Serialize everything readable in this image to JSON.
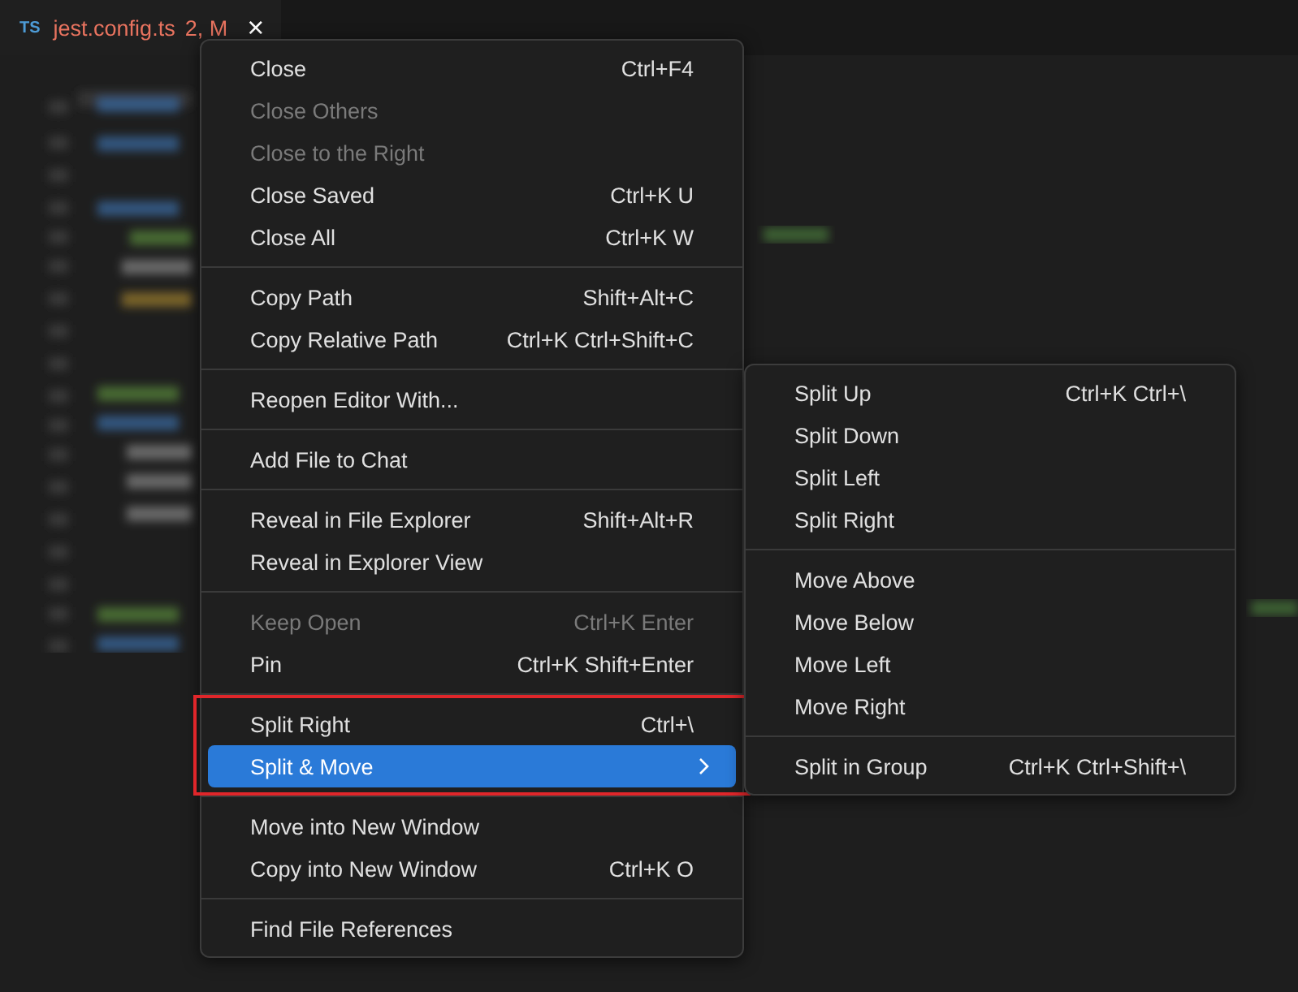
{
  "tab": {
    "type_badge": "TS",
    "filename": "jest.config.ts",
    "status": "2, M",
    "close": "×"
  },
  "context_menu": {
    "groups": [
      {
        "items": [
          {
            "label": "Close",
            "shortcut": "Ctrl+F4",
            "disabled": false,
            "selected": false,
            "submenu": false
          },
          {
            "label": "Close Others",
            "disabled": true,
            "selected": false,
            "submenu": false
          },
          {
            "label": "Close to the Right",
            "disabled": true,
            "selected": false,
            "submenu": false
          },
          {
            "label": "Close Saved",
            "shortcut": "Ctrl+K U",
            "disabled": false,
            "selected": false,
            "submenu": false
          },
          {
            "label": "Close All",
            "shortcut": "Ctrl+K W",
            "disabled": false,
            "selected": false,
            "submenu": false
          }
        ]
      },
      {
        "items": [
          {
            "label": "Copy Path",
            "shortcut": "Shift+Alt+C",
            "disabled": false,
            "selected": false,
            "submenu": false
          },
          {
            "label": "Copy Relative Path",
            "shortcut": "Ctrl+K Ctrl+Shift+C",
            "disabled": false,
            "selected": false,
            "submenu": false
          }
        ]
      },
      {
        "items": [
          {
            "label": "Reopen Editor With...",
            "disabled": false,
            "selected": false,
            "submenu": false
          }
        ]
      },
      {
        "items": [
          {
            "label": "Add File to Chat",
            "disabled": false,
            "selected": false,
            "submenu": false
          }
        ]
      },
      {
        "items": [
          {
            "label": "Reveal in File Explorer",
            "shortcut": "Shift+Alt+R",
            "disabled": false,
            "selected": false,
            "submenu": false
          },
          {
            "label": "Reveal in Explorer View",
            "disabled": false,
            "selected": false,
            "submenu": false
          }
        ]
      },
      {
        "items": [
          {
            "label": "Keep Open",
            "shortcut": "Ctrl+K Enter",
            "disabled": true,
            "selected": false,
            "submenu": false
          },
          {
            "label": "Pin",
            "shortcut": "Ctrl+K Shift+Enter",
            "disabled": false,
            "selected": false,
            "submenu": false
          }
        ]
      },
      {
        "outlined": true,
        "items": [
          {
            "label": "Split Right",
            "shortcut": "Ctrl+\\",
            "disabled": false,
            "selected": false,
            "submenu": false
          },
          {
            "label": "Split & Move",
            "disabled": false,
            "selected": true,
            "submenu": true
          }
        ]
      },
      {
        "items": [
          {
            "label": "Move into New Window",
            "disabled": false,
            "selected": false,
            "submenu": false
          },
          {
            "label": "Copy into New Window",
            "shortcut": "Ctrl+K O",
            "disabled": false,
            "selected": false,
            "submenu": false
          }
        ]
      },
      {
        "items": [
          {
            "label": "Find File References",
            "disabled": false,
            "selected": false,
            "submenu": false
          }
        ]
      }
    ]
  },
  "submenu": {
    "groups": [
      {
        "items": [
          {
            "label": "Split Up",
            "shortcut": "Ctrl+K Ctrl+\\"
          },
          {
            "label": "Split Down"
          },
          {
            "label": "Split Left"
          },
          {
            "label": "Split Right"
          }
        ]
      },
      {
        "items": [
          {
            "label": "Move Above"
          },
          {
            "label": "Move Below"
          },
          {
            "label": "Move Left"
          },
          {
            "label": "Move Right"
          }
        ]
      },
      {
        "items": [
          {
            "label": "Split in Group",
            "shortcut": "Ctrl+K Ctrl+Shift+\\"
          }
        ]
      }
    ]
  }
}
